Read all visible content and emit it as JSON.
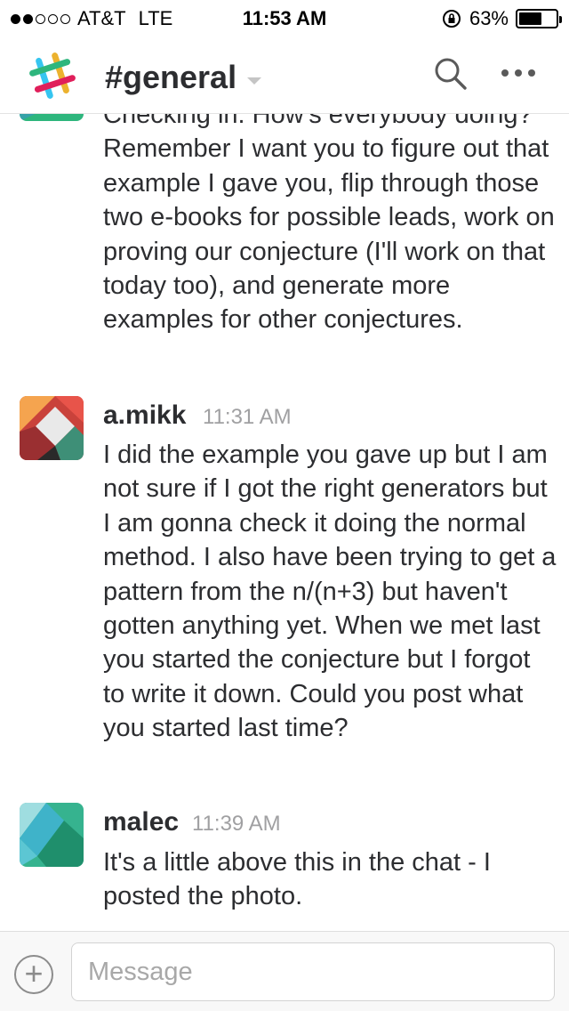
{
  "status_bar": {
    "signal_dots_filled": 2,
    "signal_dots_total": 5,
    "carrier": "AT&T",
    "network": "LTE",
    "time": "11:53 AM",
    "battery_text": "63%",
    "battery_level": 0.63
  },
  "header": {
    "channel": "#general"
  },
  "messages": [
    {
      "text": "Checking in. How's everybody doing? Remember I want you to figure out that example I gave you, flip through those two e-books for possible leads, work on proving our conjecture (I'll work on that today too), and generate more examples for other conjectures."
    },
    {
      "user": "a.mikk",
      "time": "11:31 AM",
      "text": "I did the example you gave up but I am not sure if I got the right generators but I am gonna check it doing the normal method. I also have been trying to get a pattern from the n/(n+3) but haven't gotten anything yet. When we met last you started the conjecture but I forgot to write it down. Could you post what you started last time?"
    },
    {
      "user": "malec",
      "time": "11:39 AM",
      "text": "It's a little above this in the chat - I posted the photo."
    }
  ],
  "composer": {
    "add_label": "+",
    "placeholder": "Message"
  },
  "colors": {
    "text": "#2c2d30",
    "timestamp": "#a0a0a2",
    "slack_blue": "#36c5f0",
    "slack_green": "#2eb67d",
    "slack_yellow": "#ecb22e",
    "slack_red": "#e01e5a"
  }
}
